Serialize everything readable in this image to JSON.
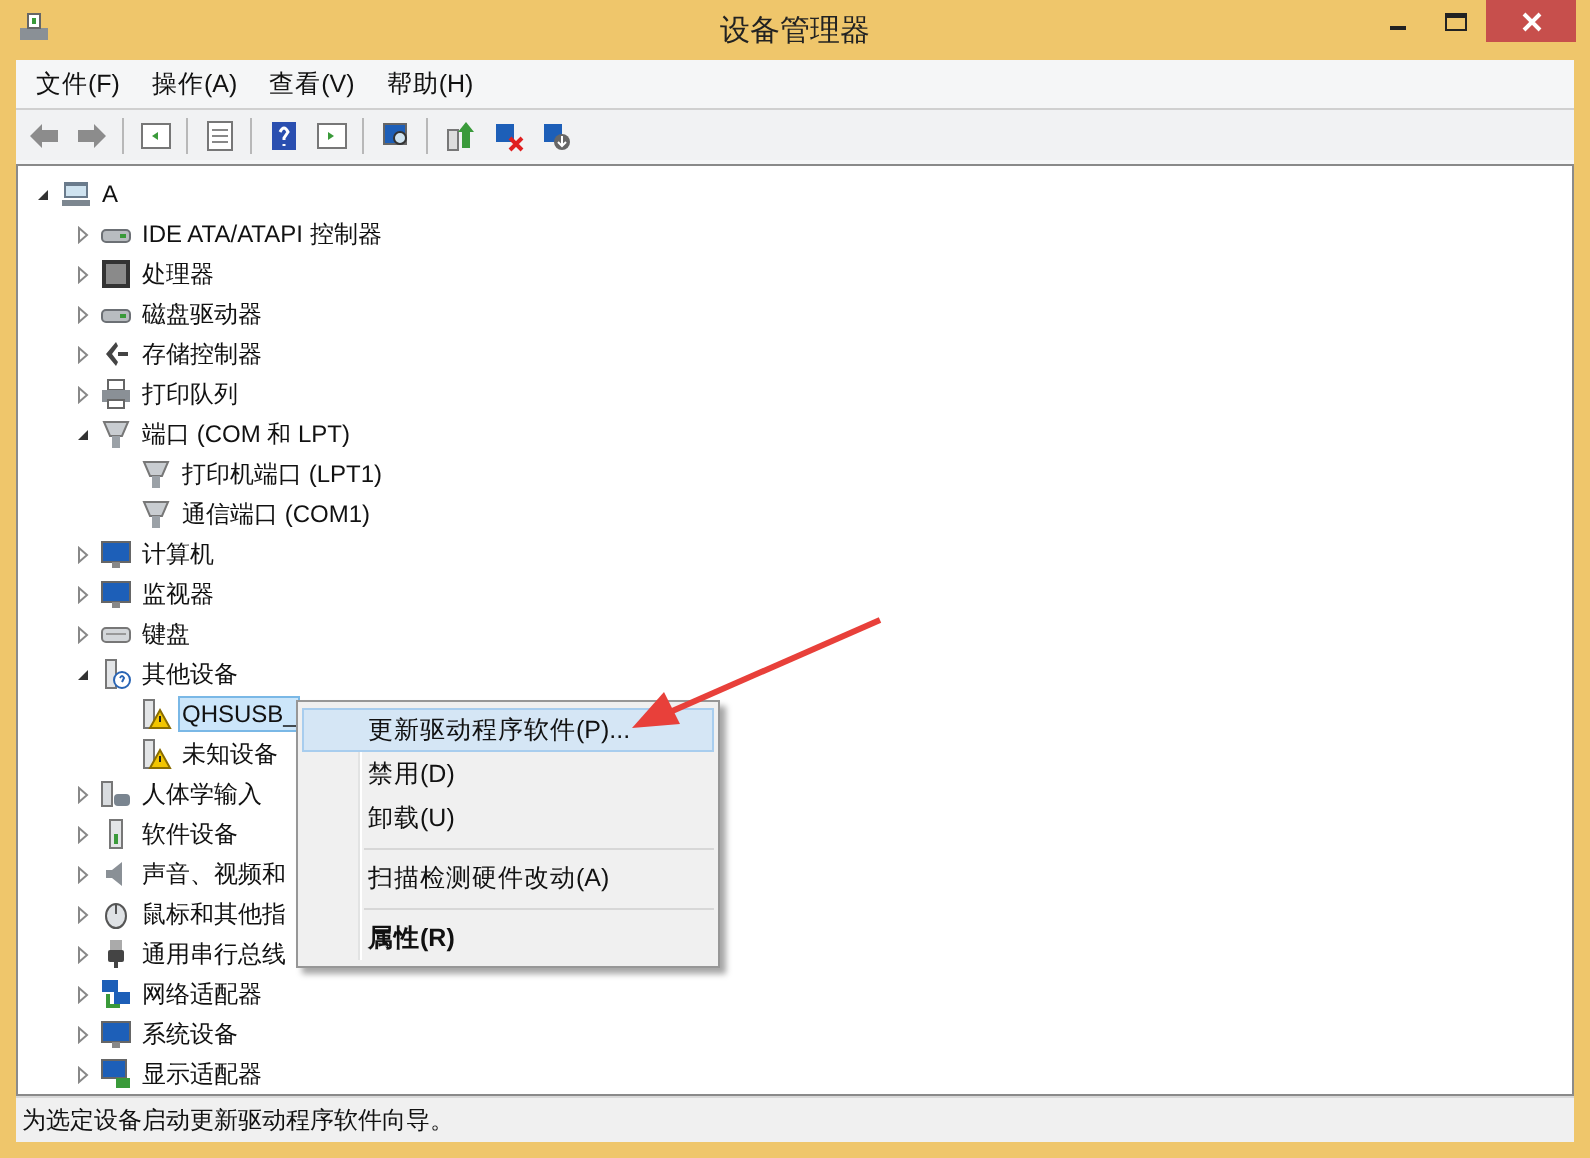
{
  "window": {
    "title": "设备管理器"
  },
  "menu": [
    "文件(F)",
    "操作(A)",
    "查看(V)",
    "帮助(H)"
  ],
  "tree": {
    "label": "A",
    "expanded": true,
    "children": [
      {
        "label": "IDE ATA/ATAPI 控制器",
        "expanded": false
      },
      {
        "label": "处理器",
        "expanded": false
      },
      {
        "label": "磁盘驱动器",
        "expanded": false
      },
      {
        "label": "存储控制器",
        "expanded": false
      },
      {
        "label": "打印队列",
        "expanded": false
      },
      {
        "label": "端口 (COM 和 LPT)",
        "expanded": true,
        "children": [
          {
            "label": "打印机端口 (LPT1)",
            "selected": false,
            "warning": false
          },
          {
            "label": "通信端口 (COM1)",
            "selected": false,
            "warning": false
          }
        ]
      },
      {
        "label": "计算机",
        "expanded": false
      },
      {
        "label": "监视器",
        "expanded": false
      },
      {
        "label": "键盘",
        "expanded": false
      },
      {
        "label": "其他设备",
        "expanded": true,
        "children": [
          {
            "label": "QHSUSB_",
            "selected": true,
            "warning": true
          },
          {
            "label": "未知设备",
            "selected": false,
            "warning": true
          }
        ]
      },
      {
        "label": "人体学输入",
        "expanded": false
      },
      {
        "label": "软件设备",
        "expanded": false
      },
      {
        "label": "声音、视频和",
        "expanded": false
      },
      {
        "label": "鼠标和其他指",
        "expanded": false
      },
      {
        "label": "通用串行总线",
        "expanded": false
      },
      {
        "label": "网络适配器",
        "expanded": false
      },
      {
        "label": "系统设备",
        "expanded": false
      },
      {
        "label": "显示适配器",
        "expanded": false
      }
    ]
  },
  "context_menu": {
    "items": [
      {
        "kind": "item",
        "label": "更新驱动程序软件(P)...",
        "selected": true,
        "bold": false
      },
      {
        "kind": "item",
        "label": "禁用(D)",
        "selected": false,
        "bold": false
      },
      {
        "kind": "item",
        "label": "卸载(U)",
        "selected": false,
        "bold": false
      },
      {
        "kind": "separator"
      },
      {
        "kind": "item",
        "label": "扫描检测硬件改动(A)",
        "selected": false,
        "bold": false
      },
      {
        "kind": "separator"
      },
      {
        "kind": "item",
        "label": "属性(R)",
        "selected": false,
        "bold": true
      }
    ]
  },
  "status_bar": "为选定设备启动更新驱动程序软件向导。"
}
